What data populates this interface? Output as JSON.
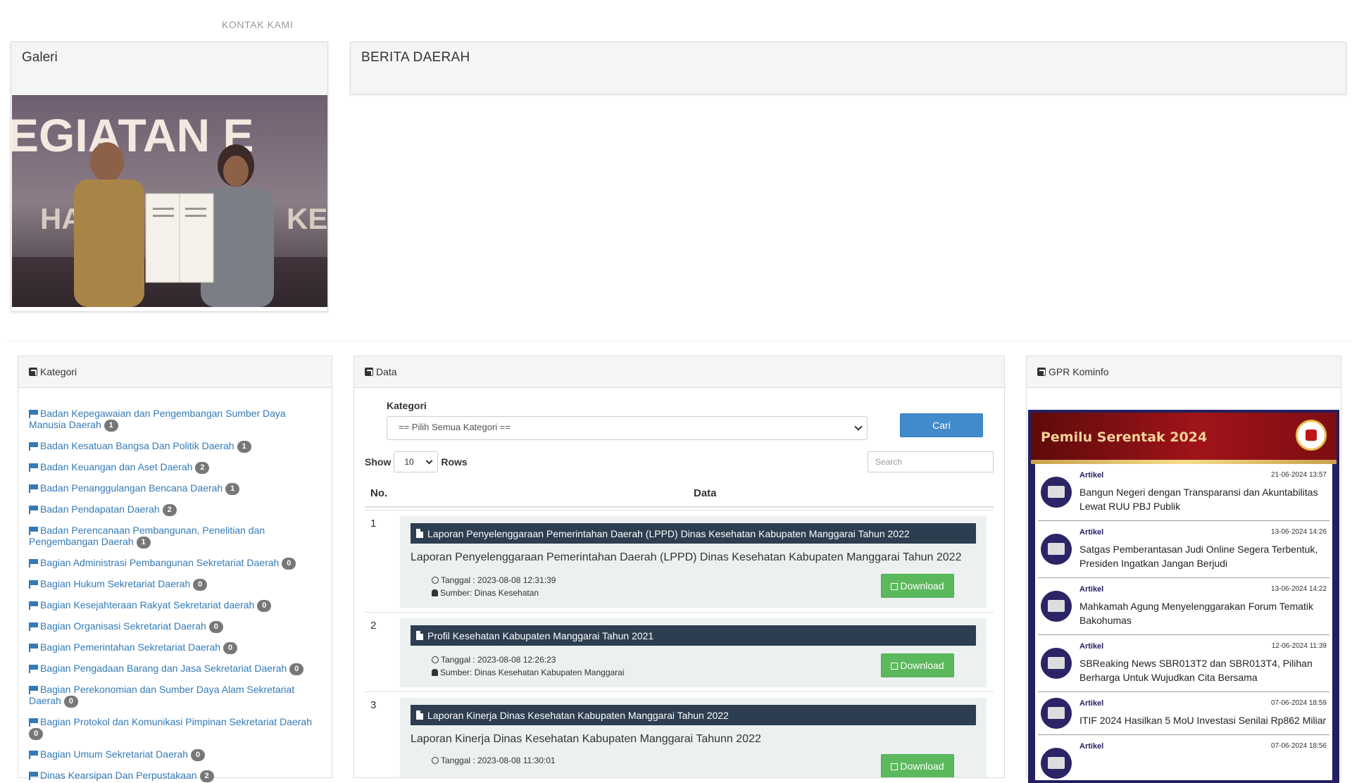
{
  "nav": {
    "contact": "KONTAK KAMI"
  },
  "galeri": {
    "title": "Galeri",
    "banner_text": "EGIATAN E",
    "banner_text2": "HAN",
    "banner_text3": "KE"
  },
  "berita": {
    "title": "BERITA DAERAH"
  },
  "kategori": {
    "title": "Kategori",
    "items": [
      {
        "label": "Badan Kepegawaian dan Pengembangan Sumber Daya Manusia Daerah",
        "count": "1"
      },
      {
        "label": "Badan Kesatuan Bangsa Dan Politik Daerah",
        "count": "1"
      },
      {
        "label": "Badan Keuangan dan Aset Daerah",
        "count": "2"
      },
      {
        "label": "Badan Penanggulangan Bencana Daerah",
        "count": "1"
      },
      {
        "label": "Badan Pendapatan Daerah",
        "count": "2"
      },
      {
        "label": "Badan Perencanaan Pembangunan, Penelitian dan Pengembangan Daerah",
        "count": "1"
      },
      {
        "label": "Bagian Administrasi Pembangunan Sekretariat Daerah",
        "count": "0"
      },
      {
        "label": "Bagian Hukum Sekretariat Daerah",
        "count": "0"
      },
      {
        "label": "Bagian Kesejahteraan Rakyat Sekretariat daerah",
        "count": "0"
      },
      {
        "label": "Bagian Organisasi Sekretariat Daerah",
        "count": "0"
      },
      {
        "label": "Bagian Pemerintahan Sekretariat Daerah",
        "count": "0"
      },
      {
        "label": "Bagian Pengadaan Barang dan Jasa Sekretariat Daerah",
        "count": "0"
      },
      {
        "label": "Bagian Perekonomian dan Sumber Daya Alam Sekretariat Daerah",
        "count": "0"
      },
      {
        "label": "Bagian Protokol dan Komunikasi Pimpinan Sekretariat Daerah",
        "count": "0"
      },
      {
        "label": "Bagian Umum Sekretariat Daerah",
        "count": "0"
      },
      {
        "label": "Dinas Kearsipan Dan Perpustakaan",
        "count": "2"
      }
    ]
  },
  "data": {
    "title": "Data",
    "kategori_label": "Kategori",
    "select_value": "== Pilih Semua Kategori ==",
    "cari_label": "Cari",
    "show_label": "Show",
    "rows_value": "10",
    "rows_label": "Rows",
    "search_placeholder": "Search",
    "col_no": "No.",
    "col_data": "Data",
    "rows": [
      {
        "no": "1",
        "title": "Laporan Penyelenggaraan Pemerintahan Daerah (LPPD) Dinas Kesehatan Kabupaten Manggarai Tahun 2022",
        "desc": "Laporan Penyelenggaraan Pemerintahan Daerah (LPPD) Dinas Kesehatan Kabupaten Manggarai Tahun 2022",
        "tanggal": "Tanggal : 2023-08-08 12:31:39",
        "sumber": "Sumber: Dinas Kesehatan",
        "download": "Download"
      },
      {
        "no": "2",
        "title": "Profil Kesehatan Kabupaten Manggarai Tahun 2021",
        "desc": "",
        "tanggal": "Tanggal : 2023-08-08 12:26:23",
        "sumber": "Sumber: Dinas Kesehatan Kabupaten Manggarai",
        "download": "Download"
      },
      {
        "no": "3",
        "title": "Laporan Kinerja Dinas Kesehatan Kabupaten Manggarai Tahun 2022",
        "desc": "Laporan Kinerja Dinas Kesehatan Kabupaten Manggarai Tahunn 2022",
        "tanggal": "Tanggal : 2023-08-08 11:30:01",
        "sumber": "",
        "download": "Download"
      }
    ]
  },
  "gpr": {
    "title": "GPR Kominfo",
    "banner": "Pemilu Serentak 2024",
    "articles": [
      {
        "cat": "Artikel",
        "date": "21-06-2024 13:57",
        "title": "Bangun Negeri dengan Transparansi dan Akuntabilitas Lewat RUU PBJ Publik"
      },
      {
        "cat": "Artikel",
        "date": "13-06-2024 14:26",
        "title": "Satgas Pemberantasan Judi Online Segera Terbentuk, Presiden Ingatkan Jangan Berjudi"
      },
      {
        "cat": "Artikel",
        "date": "13-06-2024 14:22",
        "title": "Mahkamah Agung Menyelenggarakan Forum Tematik Bakohumas"
      },
      {
        "cat": "Artikel",
        "date": "12-06-2024 11:39",
        "title": "SBReaking News SBR013T2 dan SBR013T4, Pilihan Berharga Untuk Wujudkan Cita Bersama"
      },
      {
        "cat": "Artikel",
        "date": "07-06-2024 18:59",
        "title": "ITIF 2024 Hasilkan 5 MoU Investasi Senilai Rp862 Miliar"
      },
      {
        "cat": "Artikel",
        "date": "07-06-2024 18:56",
        "title": ""
      }
    ]
  }
}
